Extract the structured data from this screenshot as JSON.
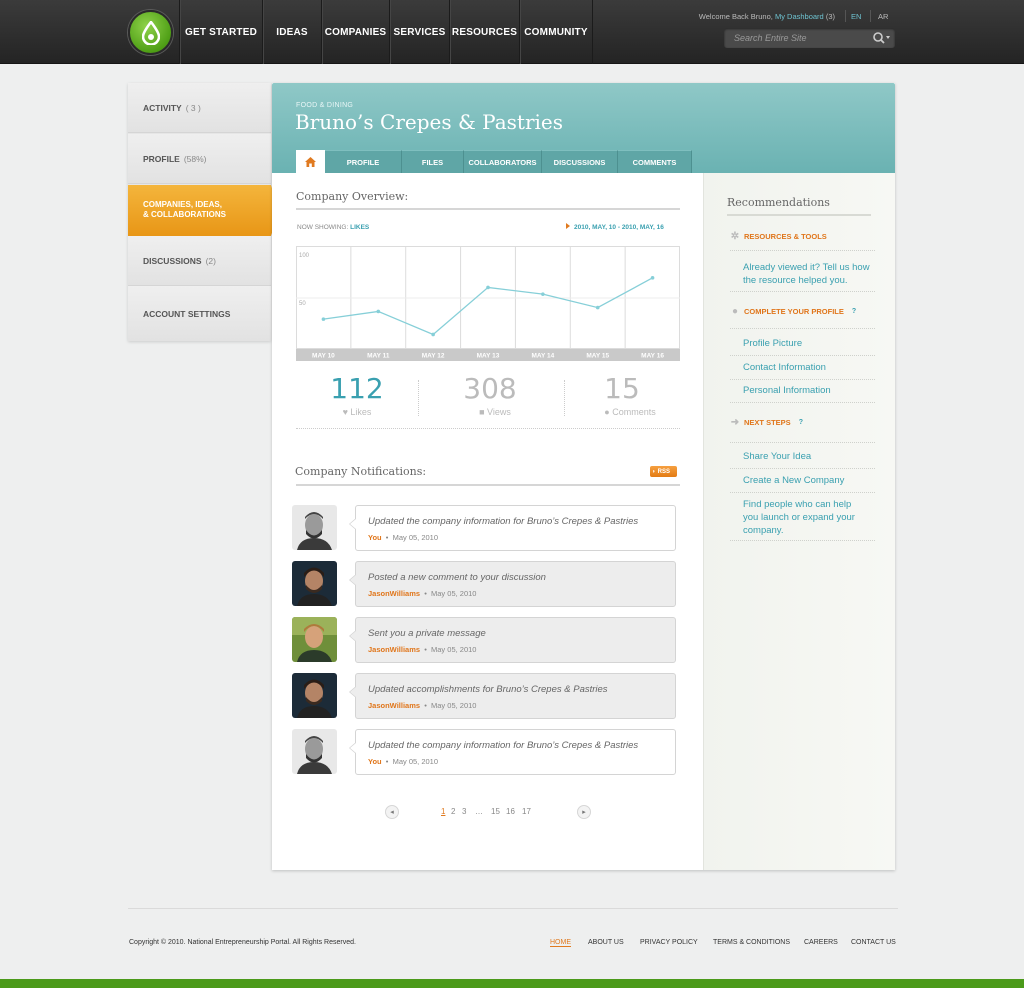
{
  "nav": {
    "items": [
      "GET STARTED",
      "IDEAS",
      "COMPANIES",
      "SERVICES",
      "RESOURCES",
      "COMMUNITY"
    ],
    "welcome_prefix": "Welcome Back Bruno,",
    "dashboard_link": "My Dashboard",
    "dashboard_count": "(3)",
    "lang_en": "EN",
    "lang_ar": "AR",
    "search_placeholder": "Search Entire Site"
  },
  "sidebar": {
    "activity": {
      "label": "ACTIVITY",
      "count": "( 3 )"
    },
    "profile": {
      "label": "PROFILE",
      "count": "(58%)"
    },
    "active_line1": "COMPANIES, IDEAS,",
    "active_line2": "& COLLABORATIONS",
    "discussions": {
      "label": "DISCUSSIONS",
      "count": "(2)"
    },
    "account": {
      "label": "ACCOUNT SETTINGS"
    }
  },
  "company": {
    "category": "FOOD & DINING",
    "title": "Bruno’s Crepes & Pastries"
  },
  "tabs": [
    "PROFILE",
    "FILES",
    "COLLABORATORS",
    "DISCUSSIONS",
    "COMMENTS"
  ],
  "overview": {
    "title": "Company Overview:",
    "now_showing_label": "NOW SHOWING:",
    "now_showing_value": "LIKES",
    "date_range": "2010, MAY, 10  - 2010, MAY, 16"
  },
  "chart_data": {
    "type": "line",
    "categories": [
      "MAY 10",
      "MAY 11",
      "MAY 12",
      "MAY 13",
      "MAY 14",
      "MAY 15",
      "MAY 16"
    ],
    "series": [
      {
        "values": [
          28,
          36,
          12,
          61,
          54,
          40,
          71
        ]
      }
    ],
    "ylim": [
      0,
      100
    ],
    "yticks": [
      0,
      50,
      100
    ],
    "ytick_labels": [
      "",
      "50",
      "100"
    ],
    "grid": true,
    "line_color": "#86cfd8"
  },
  "stats": [
    {
      "value": "112",
      "label": "Likes",
      "icon": "heart-icon",
      "color": "#3aa0b0"
    },
    {
      "value": "308",
      "label": "Views",
      "icon": "bookmark-icon",
      "color": "#bbbbbb"
    },
    {
      "value": "15",
      "label": "Comments",
      "icon": "speech-bubble-icon",
      "color": "#bbbbbb"
    }
  ],
  "notifications": {
    "title": "Company Notifications:",
    "rss": "RSS",
    "items": [
      {
        "text": "Updated the company information for Bruno’s Crepes & Pastries",
        "user": "You",
        "date": "May 05, 2010"
      },
      {
        "text": "Posted a new comment to your discussion",
        "user": "JasonWilliams",
        "date": "May 05, 2010"
      },
      {
        "text": "Sent you a private message",
        "user": "JasonWilliams",
        "date": "May 05, 2010"
      },
      {
        "text": "Updated accomplishments for Bruno’s Crepes & Pastries",
        "user": "JasonWilliams",
        "date": "May 05, 2010"
      },
      {
        "text": "Updated the company information for Bruno’s Crepes & Pastries",
        "user": "You",
        "date": "May 05, 2010"
      }
    ]
  },
  "pagination": {
    "pages": [
      "1",
      "2",
      "3",
      "…",
      "15",
      "16",
      "17"
    ],
    "current": "1"
  },
  "recommendations": {
    "title": "Recommendations",
    "resources_head": "RESOURCES & TOOLS",
    "resources_text_1": "Already viewed it? Tell us how",
    "resources_text_2": "the resource helped you.",
    "profile_head": "COMPLETE YOUR PROFILE",
    "profile_q": "?",
    "profile_links": [
      "Profile Picture",
      "Contact Information",
      "Personal Information"
    ],
    "next_head": "NEXT STEPS",
    "next_q": "?",
    "next_links": [
      "Share Your Idea",
      "Create a New Company"
    ],
    "next_find_1": "Find people who can help",
    "next_find_2": "you launch or expand your",
    "next_find_3": "company."
  },
  "footer": {
    "copyright": "Copyright © 2010. National Entrepreneurship Portal. All Rights Reserved.",
    "links": [
      "HOME",
      "ABOUT US",
      "PRIVACY POLICY",
      "TERMS & CONDITIONS",
      "CAREERS",
      "CONTACT US"
    ]
  },
  "colors": {
    "accent_teal": "#6ab2b2",
    "accent_orange": "#e89616",
    "brand_green": "#4b9a1a"
  }
}
